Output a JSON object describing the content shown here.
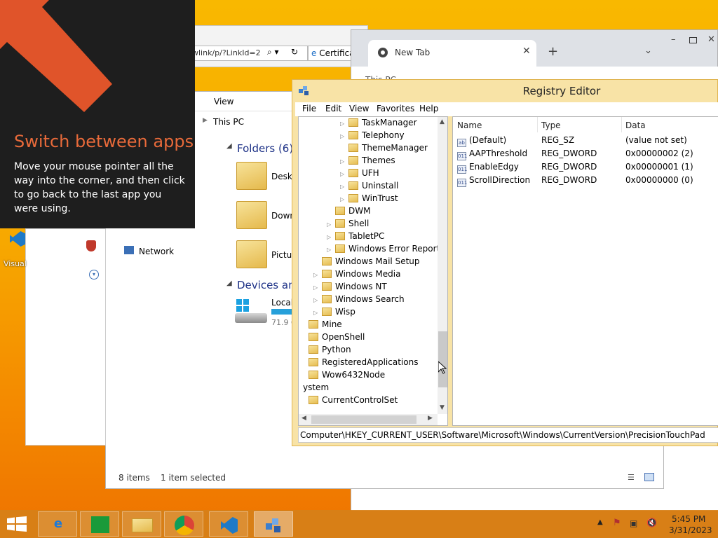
{
  "ie": {
    "address": "wlink/p/?LinkId=2",
    "tab_title": "Certifica"
  },
  "chrome": {
    "tab_title": "New Tab",
    "page_title": "This PC"
  },
  "explorer": {
    "view_label": "View",
    "address": "This PC",
    "folders_group": "Folders (6)",
    "devices_group": "Devices and",
    "items": [
      "Deskt",
      "Down",
      "Pictur"
    ],
    "device_name": "Local",
    "device_free": "71.9 G",
    "nav_network": "Network",
    "status_count": "8 items",
    "status_selected": "1 item selected"
  },
  "tip": {
    "title": "Switch between apps",
    "body": "Move your mouse pointer all the way into the corner, and then click to go back to the last app you were using."
  },
  "desktop": {
    "vs_label": "Visual"
  },
  "regedit": {
    "title": "Registry Editor",
    "menu": [
      "File",
      "Edit",
      "View",
      "Favorites",
      "Help"
    ],
    "tree": [
      {
        "label": "TaskManager",
        "depth": 3,
        "expandable": true
      },
      {
        "label": "Telephony",
        "depth": 3,
        "expandable": true
      },
      {
        "label": "ThemeManager",
        "depth": 3,
        "expandable": false
      },
      {
        "label": "Themes",
        "depth": 3,
        "expandable": true
      },
      {
        "label": "UFH",
        "depth": 3,
        "expandable": true
      },
      {
        "label": "Uninstall",
        "depth": 3,
        "expandable": true
      },
      {
        "label": "WinTrust",
        "depth": 3,
        "expandable": true
      },
      {
        "label": "DWM",
        "depth": 2,
        "expandable": false
      },
      {
        "label": "Shell",
        "depth": 2,
        "expandable": true
      },
      {
        "label": "TabletPC",
        "depth": 2,
        "expandable": true
      },
      {
        "label": "Windows Error Reporting",
        "depth": 2,
        "expandable": true
      },
      {
        "label": "Windows Mail Setup",
        "depth": 1,
        "expandable": false
      },
      {
        "label": "Windows Media",
        "depth": 1,
        "expandable": true
      },
      {
        "label": "Windows NT",
        "depth": 1,
        "expandable": true
      },
      {
        "label": "Windows Search",
        "depth": 1,
        "expandable": true
      },
      {
        "label": "Wisp",
        "depth": 1,
        "expandable": true
      },
      {
        "label": "Mine",
        "depth": 0,
        "expandable": false
      },
      {
        "label": "OpenShell",
        "depth": 0,
        "expandable": false
      },
      {
        "label": "Python",
        "depth": 0,
        "expandable": false
      },
      {
        "label": "RegisteredApplications",
        "depth": 0,
        "expandable": false
      },
      {
        "label": "Wow6432Node",
        "depth": 0,
        "expandable": false
      },
      {
        "label": "ystem",
        "depth": -1,
        "expandable": false
      },
      {
        "label": "CurrentControlSet",
        "depth": 0,
        "expandable": false
      }
    ],
    "columns": [
      "Name",
      "Type",
      "Data"
    ],
    "values": [
      {
        "name": "(Default)",
        "type": "REG_SZ",
        "data": "(value not set)",
        "icon": "ab"
      },
      {
        "name": "AAPThreshold",
        "type": "REG_DWORD",
        "data": "0x00000002 (2)",
        "icon": "011"
      },
      {
        "name": "EnableEdgy",
        "type": "REG_DWORD",
        "data": "0x00000001 (1)",
        "icon": "011"
      },
      {
        "name": "ScrollDirection",
        "type": "REG_DWORD",
        "data": "0x00000000 (0)",
        "icon": "011"
      }
    ],
    "status_path": "Computer\\HKEY_CURRENT_USER\\Software\\Microsoft\\Windows\\CurrentVersion\\PrecisionTouchPad"
  },
  "taskbar": {
    "time": "5:45 PM",
    "date": "3/31/2023"
  }
}
